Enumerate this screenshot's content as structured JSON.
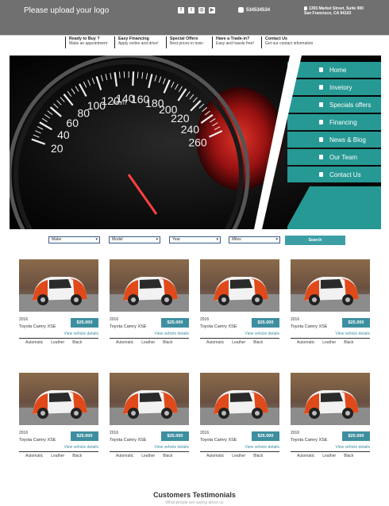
{
  "header": {
    "logo_text": "Please upload your logo",
    "phone": "534534534",
    "address": "1355 Market Street, Suite 900 San Francisco, CA 94103",
    "socials": [
      "f",
      "t",
      "◎",
      "▶"
    ]
  },
  "info_strip": [
    {
      "title": "Ready to Buy ?",
      "subtitle": "Make an appointment"
    },
    {
      "title": "Easy Financing",
      "subtitle": "Apply online and drive!"
    },
    {
      "title": "Special Offers",
      "subtitle": "Best prices in town"
    },
    {
      "title": "Have a Trade-in?",
      "subtitle": "Easy and hassle free!"
    },
    {
      "title": "Contact Us",
      "subtitle": "Get our contact information"
    }
  ],
  "menu": [
    {
      "label": "Home"
    },
    {
      "label": "Invetory"
    },
    {
      "label": "Specials offers"
    },
    {
      "label": "Financing"
    },
    {
      "label": "News & Blog"
    },
    {
      "label": "Our Team"
    },
    {
      "label": "Contact Us"
    }
  ],
  "search": {
    "make": "Make",
    "model": "Model",
    "year": "Year",
    "miles": "Miles",
    "button": "Search"
  },
  "cards": [
    {
      "year": "2016",
      "name": "Toyota Camry XSE",
      "price": "$25.000",
      "details": "View vehicle details",
      "specs": [
        "Automatic",
        "Leather",
        "Black"
      ]
    },
    {
      "year": "2016",
      "name": "Toyota Camry XSE",
      "price": "$25.000",
      "details": "View vehicle details",
      "specs": [
        "Automatic",
        "Leather",
        "Black"
      ]
    },
    {
      "year": "2016",
      "name": "Toyota Camry XSE",
      "price": "$25.000",
      "details": "View vehicle details",
      "specs": [
        "Automatic",
        "Leather",
        "Black"
      ]
    },
    {
      "year": "2016",
      "name": "Toyota Camry XSE",
      "price": "$25.000",
      "details": "View vehicle details",
      "specs": [
        "Automatic",
        "Leather",
        "Black"
      ]
    },
    {
      "year": "2016",
      "name": "Toyota Camry XSE",
      "price": "$25.000",
      "details": "View vehicle details",
      "specs": [
        "Automatic",
        "Leather",
        "Black"
      ]
    },
    {
      "year": "2016",
      "name": "Toyota Camry XSE",
      "price": "$25.000",
      "details": "View vehicle details",
      "specs": [
        "Automatic",
        "Leather",
        "Black"
      ]
    },
    {
      "year": "2016",
      "name": "Toyota Camry XSE",
      "price": "$25.000",
      "details": "View vehicle details",
      "specs": [
        "Automatic",
        "Leather",
        "Black"
      ]
    },
    {
      "year": "2016",
      "name": "Toyota Camry XSE",
      "price": "$25.000",
      "details": "View vehicle details",
      "specs": [
        "Automatic",
        "Leather",
        "Black"
      ]
    }
  ],
  "testimonials": {
    "title": "Customers Testimonials",
    "subtitle": "What people are saying about us"
  },
  "gauge_labels": [
    "20",
    "40",
    "60",
    "80",
    "100",
    "120",
    "140",
    "160",
    "180",
    "200",
    "220",
    "240",
    "260",
    "km/h"
  ],
  "colors": {
    "menu": "#269994",
    "price": "#3d8fa0",
    "topbar": "#707070",
    "accent_red": "#e52222"
  }
}
